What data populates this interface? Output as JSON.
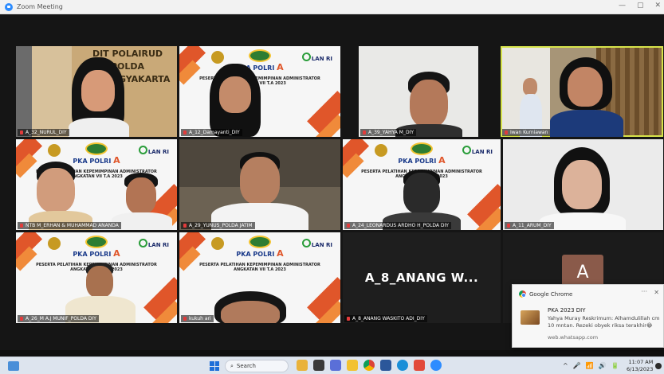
{
  "window": {
    "title": "Zoom Meeting",
    "controls": [
      "—",
      "▢",
      "✕"
    ]
  },
  "participants": [
    {
      "name": "A_32_NURUL_DIY",
      "background": "room"
    },
    {
      "name": "A_12_Damayanti_DIY",
      "background": "slide"
    },
    {
      "name": "A_39_YAHYA M_DIY",
      "background": "room"
    },
    {
      "name": "Iwan Kurniawan",
      "background": "room",
      "active": true
    },
    {
      "name": "NTB M_ERHAN & MUHAMMAD ANANDA",
      "background": "slide"
    },
    {
      "name": "A_29_YUNUS_POLDA JATIM",
      "background": "room"
    },
    {
      "name": "A_24_LEONARDUS ARDHO H_POLDA DIY",
      "background": "slide"
    },
    {
      "name": "A_11_ARUM_DIY",
      "background": "room"
    },
    {
      "name": "A_26_M A.J MUNIF_POLDA DIY",
      "background": "slide"
    },
    {
      "name": "kukuh ari",
      "background": "slide"
    },
    {
      "name": "A_8_ANANG WASKITO ADI_DIY",
      "display": "A_8_ANANG W..."
    },
    {
      "name": "",
      "initial": "A"
    }
  ],
  "slide": {
    "brand": "PKA POLRI",
    "brand_suffix": "A",
    "partner": "LAN RI",
    "caption_line1": "PESERTA PELATIHAN KEPEMIMPINAN ADMINISTRATOR",
    "caption_line2": "ANGKATAN VII T.A 2023"
  },
  "room_sign": {
    "line1": "DIT POLAIRUD",
    "line2": "POLDA",
    "line3": "D.I. YOGYAKARTA"
  },
  "notification": {
    "app": "Google Chrome",
    "title": "PKA 2023 DIY",
    "body": "Yahya Muray Reskrimum: Alhamdulillah cm 10 mntan. Rezeki obyek riksa terakhir😂",
    "source": "web.whatsapp.com",
    "dots": "···",
    "close": "✕"
  },
  "taskbar": {
    "search_label": "Search",
    "time": "11:07 AM",
    "date": "6/13/2023",
    "tray_icons": [
      "^",
      "🎤",
      "📶",
      "🔊",
      "🔋"
    ]
  },
  "colors": {
    "active_border": "#d6e34a",
    "slide_orange": "#e0562a",
    "zoom_blue": "#2d8cff"
  }
}
